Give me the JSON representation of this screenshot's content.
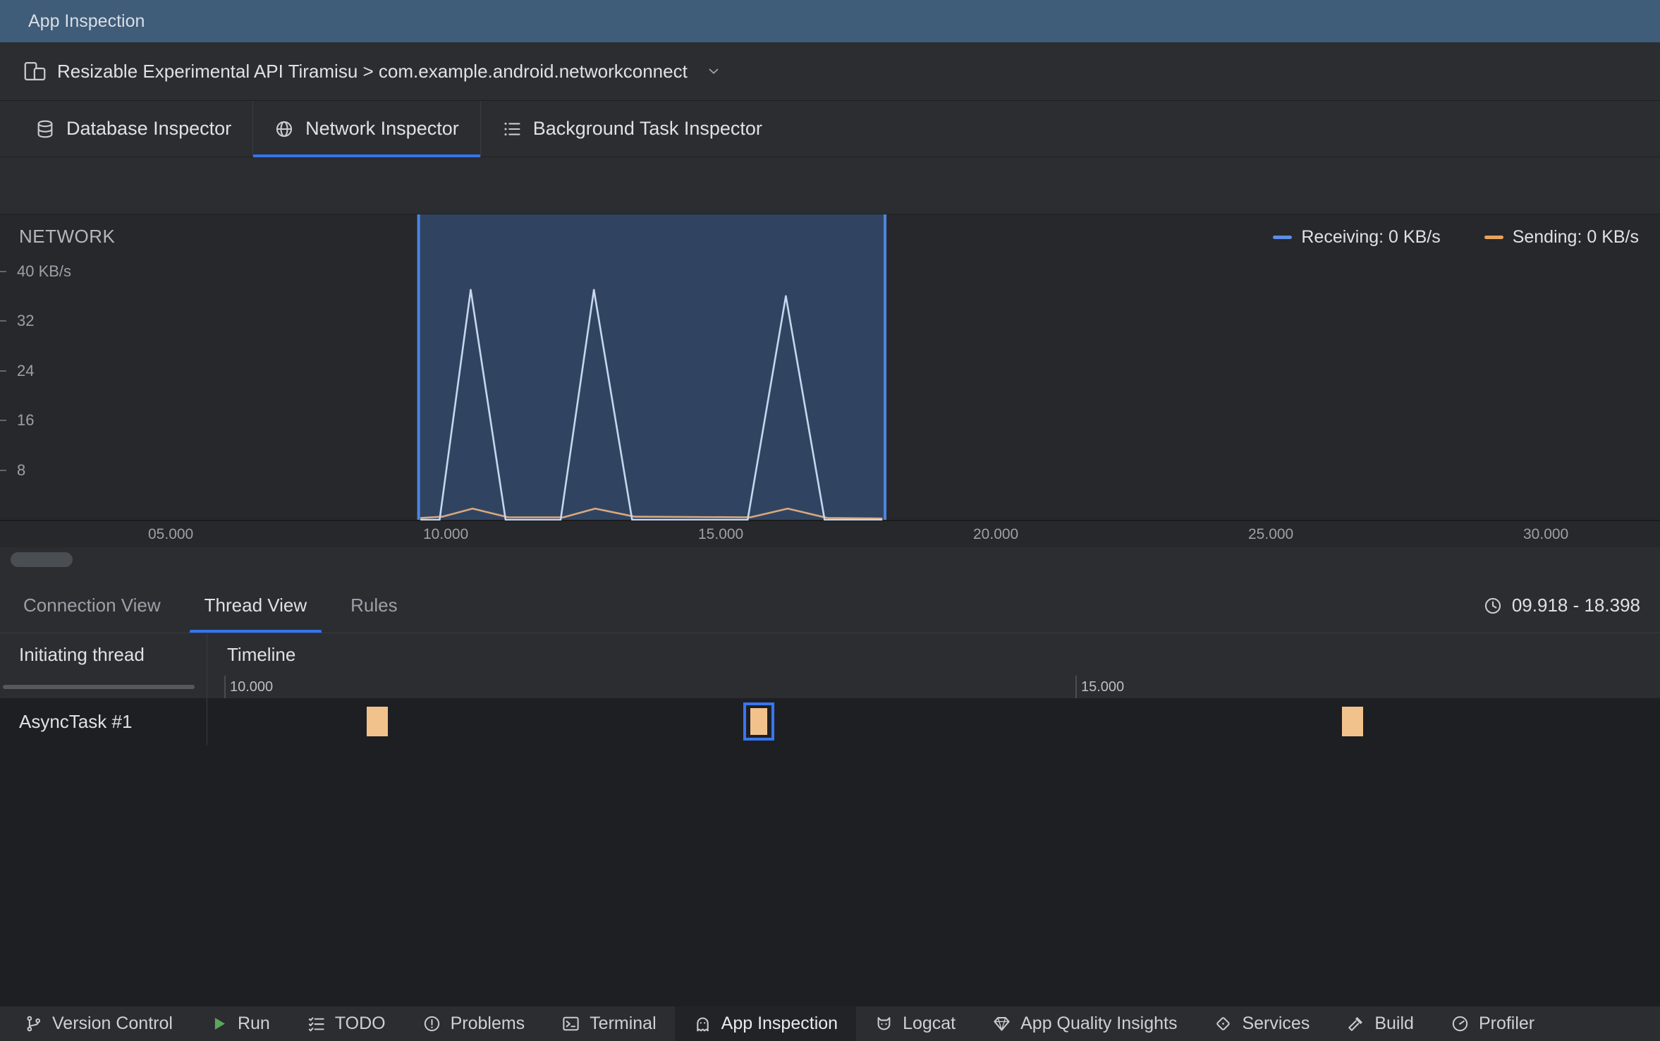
{
  "window": {
    "title": "App Inspection"
  },
  "device_bar": {
    "label": "Resizable Experimental API Tiramisu > com.example.android.networkconnect"
  },
  "inspector_tabs": [
    {
      "label": "Database Inspector",
      "icon": "database-icon",
      "selected": false
    },
    {
      "label": "Network Inspector",
      "icon": "globe-icon",
      "selected": true
    },
    {
      "label": "Background Task Inspector",
      "icon": "checklist-icon",
      "selected": false
    }
  ],
  "network_chart": {
    "type": "area",
    "title": "NETWORK",
    "unit": "KB/s",
    "legend": [
      {
        "label": "Receiving: 0 KB/s",
        "color": "#5D8EE2"
      },
      {
        "label": "Sending: 0 KB/s",
        "color": "#E8A45C"
      }
    ],
    "y_ticks": [
      {
        "value": 40,
        "label": "40 KB/s"
      },
      {
        "value": 32,
        "label": "32"
      },
      {
        "value": 24,
        "label": "24"
      },
      {
        "value": 16,
        "label": "16"
      },
      {
        "value": 8,
        "label": "8"
      }
    ],
    "x_ticks": [
      {
        "value": 5,
        "label": "05.000"
      },
      {
        "value": 10,
        "label": "10.000"
      },
      {
        "value": 15,
        "label": "15.000"
      },
      {
        "value": 20,
        "label": "20.000"
      },
      {
        "value": 25,
        "label": "25.000"
      },
      {
        "value": 30,
        "label": "30.000"
      }
    ],
    "selection": {
      "start_s": 9.918,
      "end_s": 18.398,
      "fill": "#3D6CAB",
      "edge": "#4C86E0"
    },
    "series": [
      {
        "name": "Receiving",
        "stroke": "#C7D6EE",
        "points": [
          [
            9.95,
            0
          ],
          [
            10.3,
            0
          ],
          [
            10.865,
            37
          ],
          [
            11.5,
            0
          ],
          [
            12.5,
            0
          ],
          [
            13.105,
            37
          ],
          [
            13.8,
            0
          ],
          [
            15.9,
            0
          ],
          [
            16.595,
            36
          ],
          [
            17.3,
            0
          ],
          [
            18.35,
            0
          ]
        ]
      },
      {
        "name": "Sending",
        "stroke": "#D9A87C",
        "points": [
          [
            9.95,
            0.3
          ],
          [
            10.35,
            0.5
          ],
          [
            10.9,
            1.8
          ],
          [
            11.55,
            0.4
          ],
          [
            12.55,
            0.4
          ],
          [
            13.13,
            1.8
          ],
          [
            13.85,
            0.5
          ],
          [
            15.95,
            0.4
          ],
          [
            16.63,
            1.8
          ],
          [
            17.35,
            0.3
          ],
          [
            18.35,
            0.2
          ]
        ]
      }
    ]
  },
  "view_tabs": [
    {
      "label": "Connection View",
      "selected": false
    },
    {
      "label": "Thread View",
      "selected": true
    },
    {
      "label": "Rules",
      "selected": false
    }
  ],
  "time_range": {
    "label": "09.918 - 18.398"
  },
  "thread_table": {
    "columns": [
      "Initiating thread",
      "Timeline"
    ],
    "ruler_ticks": [
      {
        "value": 10,
        "label": "10.000"
      },
      {
        "value": 15,
        "label": "15.000"
      }
    ],
    "rows": [
      {
        "thread": "AsyncTask #1",
        "blocks": [
          {
            "start_s": 10.8,
            "end_s": 10.93,
            "selected": false
          },
          {
            "start_s": 13.04,
            "end_s": 13.17,
            "selected": true
          },
          {
            "start_s": 16.53,
            "end_s": 16.66,
            "selected": false
          }
        ]
      }
    ],
    "block_color": "#F2C28C",
    "selection_color": "#3876F2"
  },
  "status_bar": [
    {
      "label": "Version Control",
      "icon": "branch-icon",
      "selected": false
    },
    {
      "label": "Run",
      "icon": "play-icon",
      "selected": false
    },
    {
      "label": "TODO",
      "icon": "todo-icon",
      "selected": false
    },
    {
      "label": "Problems",
      "icon": "problems-icon",
      "selected": false
    },
    {
      "label": "Terminal",
      "icon": "terminal-icon",
      "selected": false
    },
    {
      "label": "App Inspection",
      "icon": "app-inspection-icon",
      "selected": true
    },
    {
      "label": "Logcat",
      "icon": "logcat-icon",
      "selected": false
    },
    {
      "label": "App Quality Insights",
      "icon": "gem-icon",
      "selected": false
    },
    {
      "label": "Services",
      "icon": "services-icon",
      "selected": false
    },
    {
      "label": "Build",
      "icon": "build-icon",
      "selected": false
    },
    {
      "label": "Profiler",
      "icon": "profiler-icon",
      "selected": false
    }
  ]
}
